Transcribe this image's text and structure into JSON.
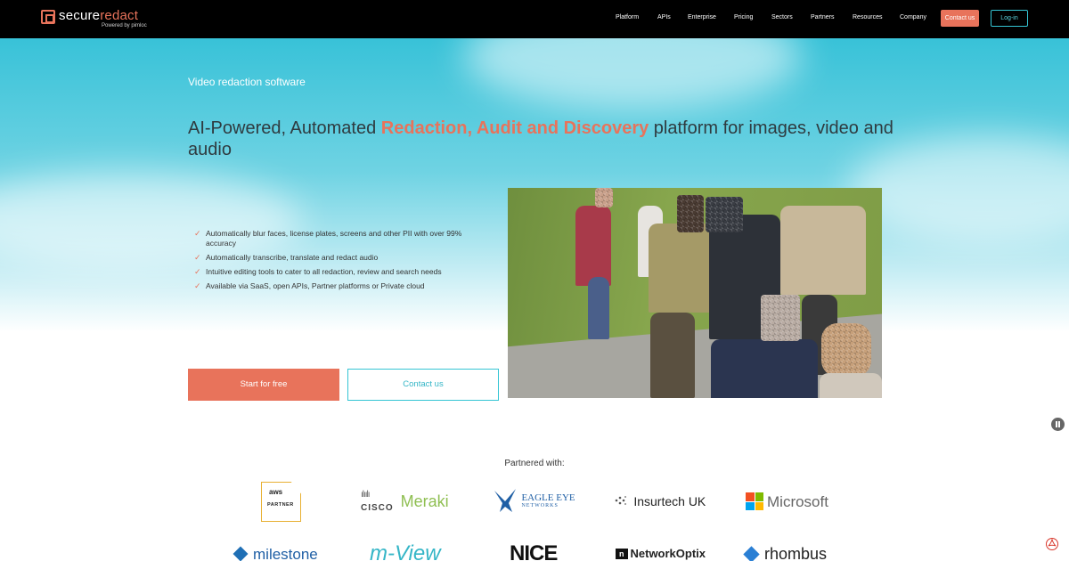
{
  "nav": {
    "logo": {
      "part1": "secure",
      "part2": "redact",
      "sub": "Powered by pimloc"
    },
    "items": [
      "Platform",
      "APIs",
      "Enterprise",
      "Pricing",
      "Sectors",
      "Partners",
      "Resources",
      "Company"
    ],
    "contact": "Contact us",
    "login": "Log-in"
  },
  "hero": {
    "eyebrow": "Video redaction software",
    "title_pre": "AI-Powered, Automated ",
    "title_accent": "Redaction, Audit and Discovery",
    "title_post": " platform for images, video and audio",
    "features": [
      "Automatically blur faces, license plates, screens and other PII with over 99% accuracy",
      "Automatically transcribe, translate and redact audio",
      "Intuitive editing tools to cater to all redaction, review and search needs",
      "Available via SaaS, open APIs, Partner platforms or Private cloud"
    ],
    "check_glyph": "✓",
    "start_button": "Start for free",
    "contact_button": "Contact us"
  },
  "partners": {
    "title": "Partnered with:",
    "aws": {
      "top": "aws",
      "bottom": "PARTNER"
    },
    "cisco": {
      "bars": "ılıılı",
      "word": "CISCO",
      "name": "Meraki"
    },
    "eagle": {
      "line1": "EAGLE EYE",
      "line2": "NETWORKS"
    },
    "insurtech": "Insurtech UK",
    "microsoft": "Microsoft",
    "milestone": "milestone",
    "mview": "m-View",
    "nice": "NICE",
    "networkoptix": {
      "box": "n",
      "name": "NetworkOptix"
    },
    "rhombus": "rhombus"
  },
  "colors": {
    "accent": "#e8735b",
    "cyan": "#35c5d4",
    "nav_bg": "#000000"
  }
}
